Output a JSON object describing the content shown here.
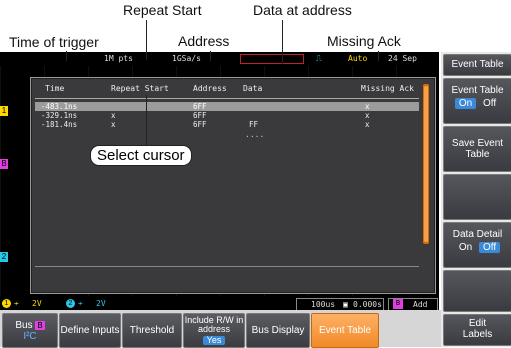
{
  "callouts": {
    "time_of_trigger": "Time of trigger",
    "repeat_start": "Repeat Start",
    "address": "Address",
    "data_at_address": "Data at address",
    "missing_ack": "Missing Ack",
    "select_cursor": "Select cursor"
  },
  "topbar": {
    "points": "1M pts",
    "sample_rate": "1GSa/s",
    "trigger_mode": "Auto",
    "date": "24 Sep"
  },
  "event_table": {
    "headers": [
      "Time",
      "Repeat Start",
      "Address",
      "Data",
      "Missing Ack"
    ],
    "rows": [
      {
        "time": "-483.1ns",
        "repeat_start": "",
        "address": "6FF",
        "data": "",
        "missing_ack": "x"
      },
      {
        "time": "-329.1ns",
        "repeat_start": "x",
        "address": "6FF",
        "data": "",
        "missing_ack": "x"
      },
      {
        "time": "-181.4ns",
        "repeat_start": "x",
        "address": "6FF",
        "data": "FF",
        "missing_ack": "x"
      }
    ],
    "ellipsis": "....",
    "selected_row": 0
  },
  "status": {
    "ch1_scale": "2V",
    "ch2_scale": "2V",
    "timebase": "100us",
    "trigger_pos": "0.000s",
    "bus_label": "Add"
  },
  "side_menu": {
    "title": "Event Table",
    "event_table_label": "Event Table",
    "on": "On",
    "off": "Off",
    "save_label": "Save Event Table",
    "data_detail_label": "Data Detail",
    "data_on": "On",
    "data_off": "Off"
  },
  "bottom_menu": {
    "bus": "Bus",
    "bus_badge": "B",
    "bus_type": "I²C",
    "define_inputs": "Define Inputs",
    "threshold": "Threshold",
    "include_rw": "Include R/W in address",
    "include_rw_value": "Yes",
    "bus_display": "Bus Display",
    "event_table": "Event Table",
    "edit_labels": "Edit Labels"
  },
  "colors": {
    "ch1": "#ffd800",
    "ch2": "#28c8e8",
    "ch3": "#e040e0",
    "accent_orange": "#f08a26",
    "selected_blue": "#3a8ad8"
  }
}
